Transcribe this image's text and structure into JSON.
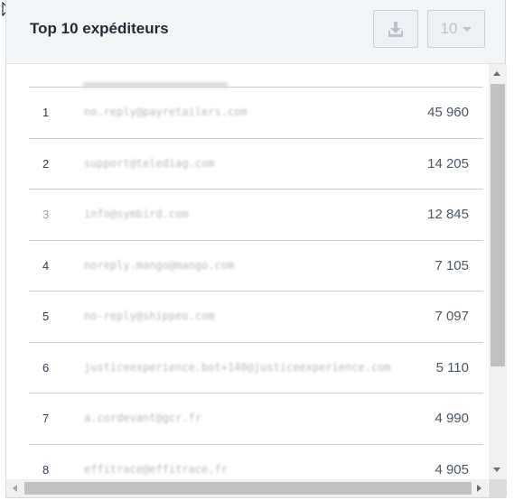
{
  "panel": {
    "title": "Top 10 expéditeurs",
    "download_icon": "download-icon",
    "page_size": "10",
    "page_size_icon": "chevron-down-icon"
  },
  "rows": [
    {
      "rank": "1",
      "sender": "no.reply@payretailers.com",
      "count": "45 960"
    },
    {
      "rank": "2",
      "sender": "support@telediag.com",
      "count": "14 205"
    },
    {
      "rank": "3",
      "sender": "info@symbird.com",
      "count": "12 845"
    },
    {
      "rank": "4",
      "sender": "noreply.mango@mango.com",
      "count": "7 105"
    },
    {
      "rank": "5",
      "sender": "no-reply@shippeo.com",
      "count": "7 097"
    },
    {
      "rank": "6",
      "sender": "justiceexperience.bot+140@justiceexperience.com",
      "count": "5 110"
    },
    {
      "rank": "7",
      "sender": "a.cordevant@gcr.fr",
      "count": "4 990"
    },
    {
      "rank": "8",
      "sender": "effitrace@effitrace.fr",
      "count": "4 905"
    }
  ],
  "colors": {
    "header_bg": "#f3f6f9",
    "divider": "#c8d1da",
    "text": "#1f2a36",
    "scrollbar_thumb": "#c1c1c1"
  }
}
